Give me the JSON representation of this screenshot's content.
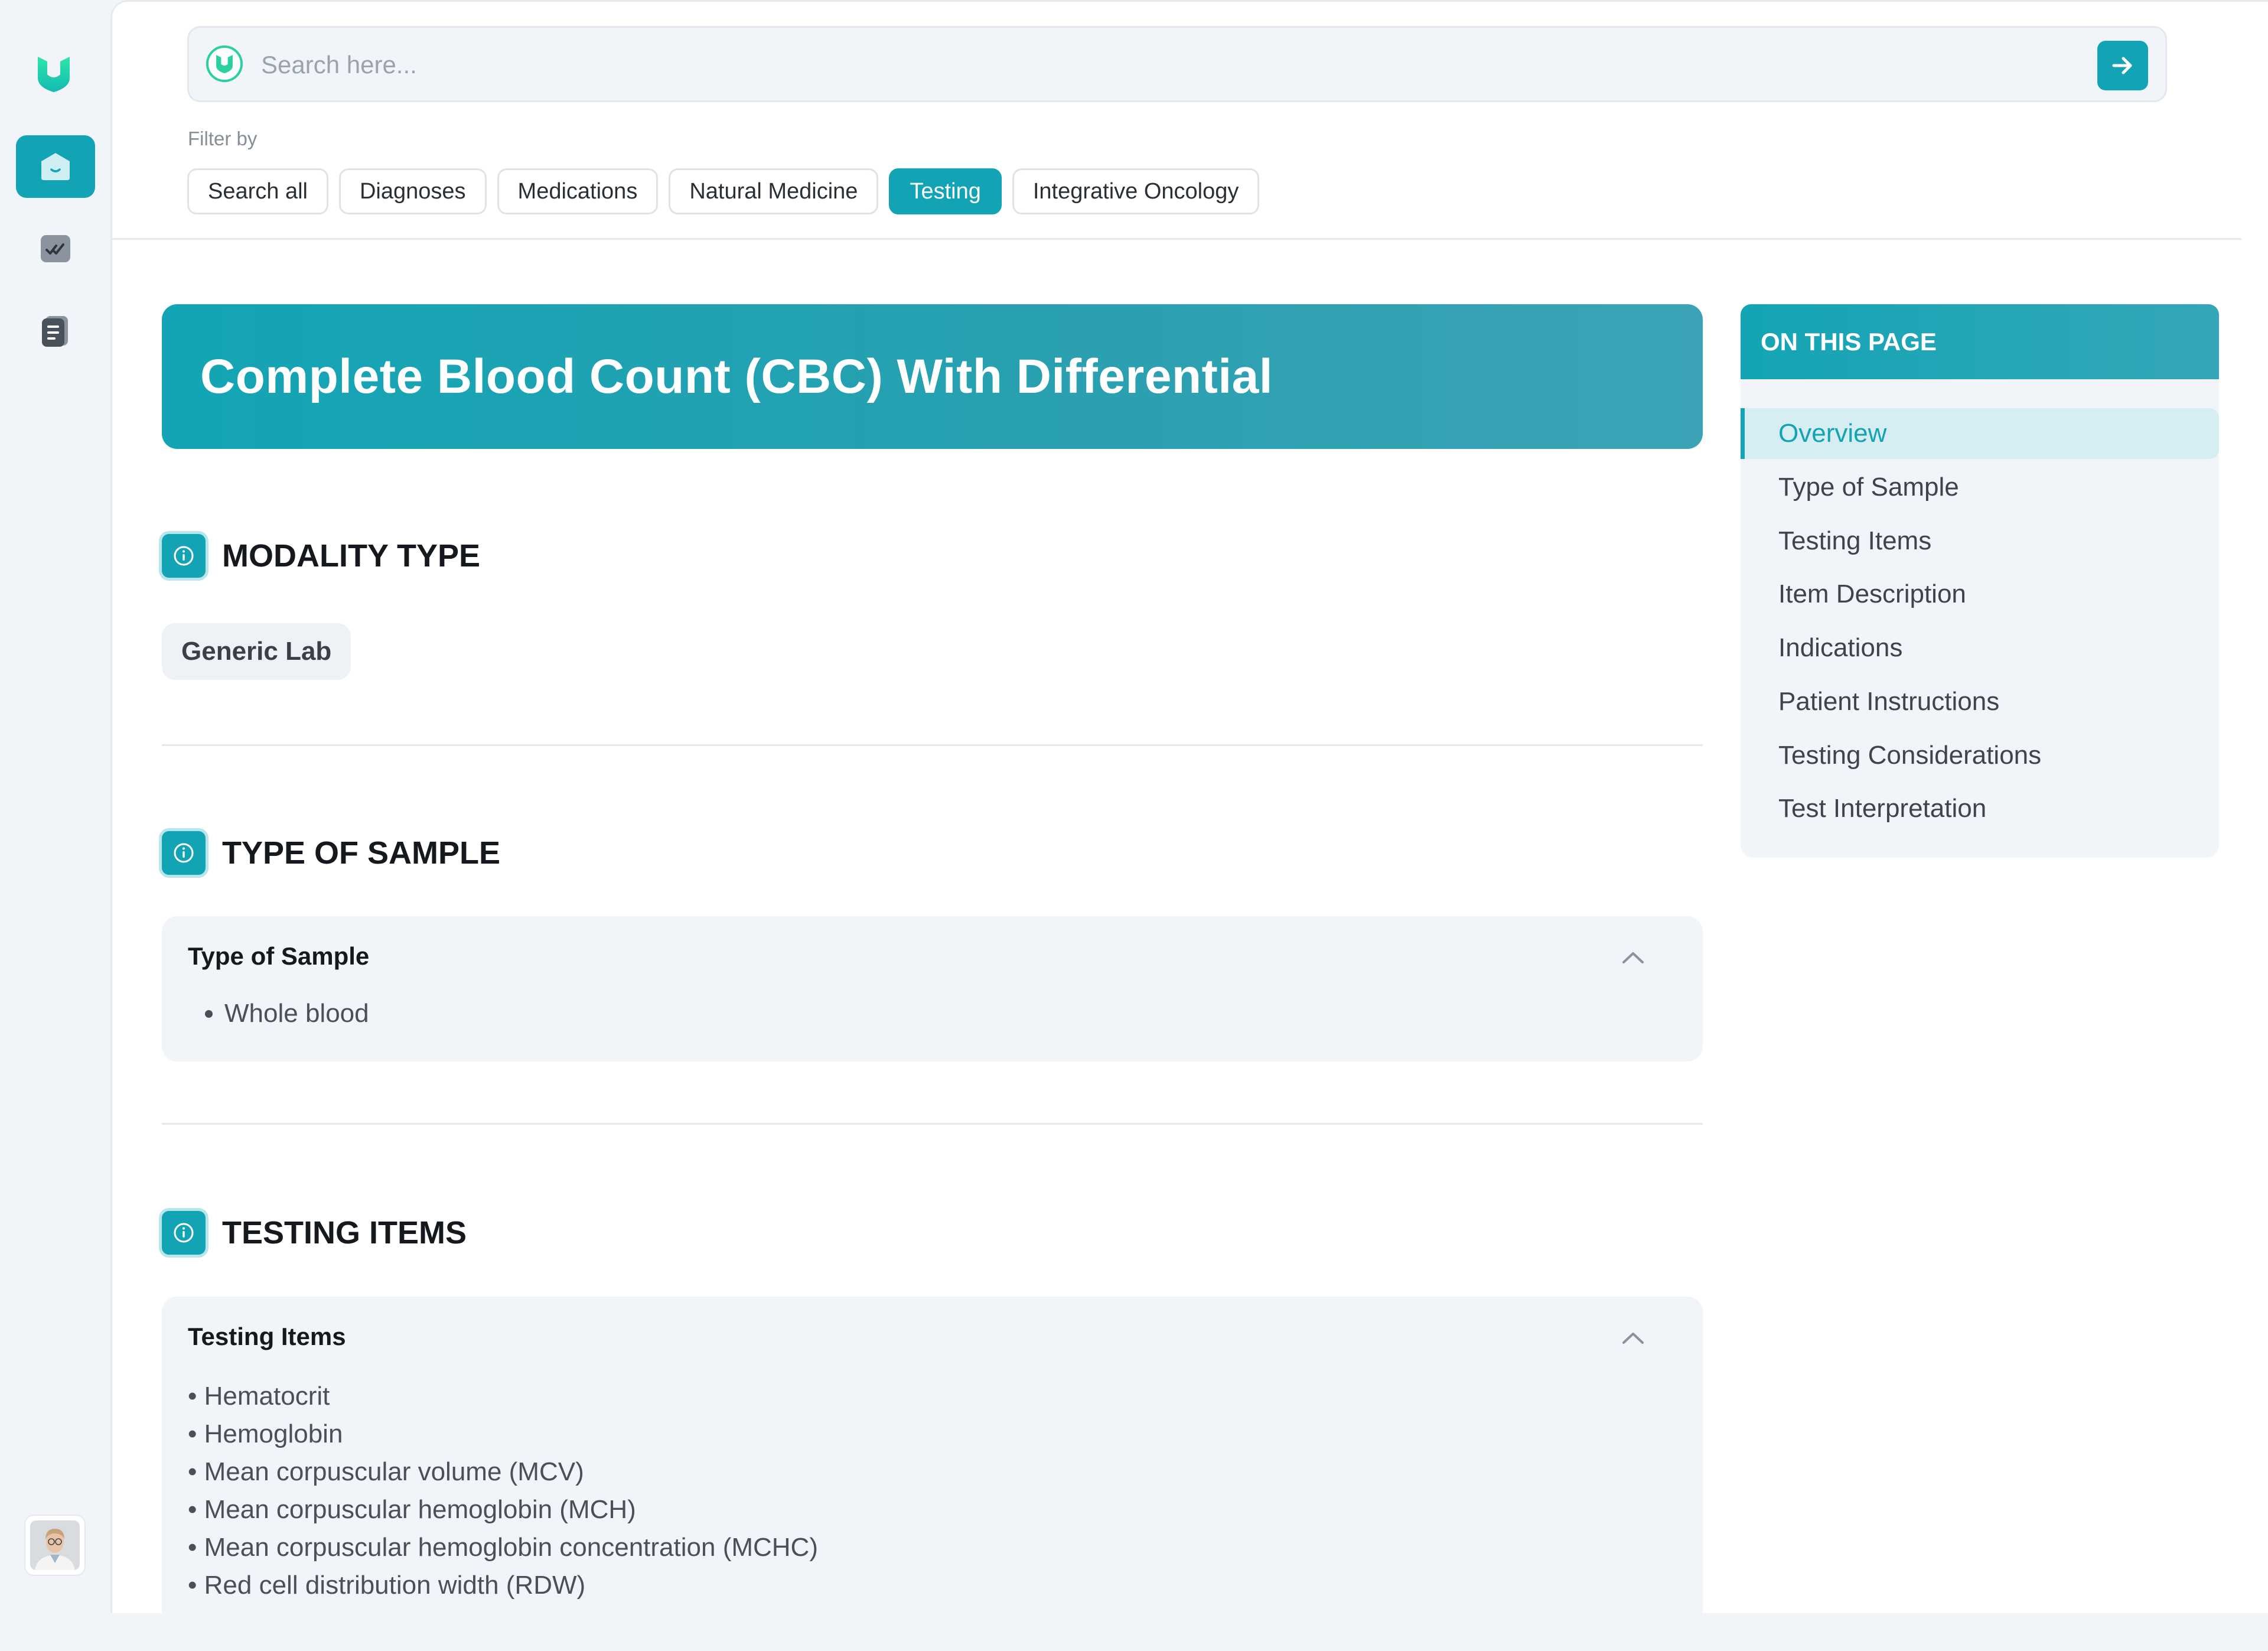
{
  "search": {
    "placeholder": "Search here..."
  },
  "filters": {
    "label": "Filter by",
    "chips": [
      {
        "label": "Search all",
        "active": false
      },
      {
        "label": "Diagnoses",
        "active": false
      },
      {
        "label": "Medications",
        "active": false
      },
      {
        "label": "Natural Medicine",
        "active": false
      },
      {
        "label": "Testing",
        "active": true
      },
      {
        "label": "Integrative Oncology",
        "active": false
      }
    ]
  },
  "page": {
    "title": "Complete Blood Count (CBC) With Differential"
  },
  "sections": {
    "modality": {
      "heading": "MODALITY TYPE",
      "value": "Generic Lab"
    },
    "sample": {
      "heading": "TYPE OF SAMPLE",
      "panel_title": "Type of Sample",
      "items": [
        "Whole blood"
      ]
    },
    "testing": {
      "heading": "TESTING ITEMS",
      "panel_title": "Testing Items",
      "items": [
        "• Hematocrit",
        "• Hemoglobin",
        "• Mean corpuscular volume (MCV)",
        "• Mean corpuscular hemoglobin (MCH)",
        "• Mean corpuscular hemoglobin concentration (MCHC)",
        "• Red cell distribution width (RDW)"
      ]
    }
  },
  "toc": {
    "title": "ON THIS PAGE",
    "items": [
      "Overview",
      "Type of Sample",
      "Testing Items",
      "Item Description",
      "Indications",
      "Patient Instructions",
      "Testing Considerations",
      "Test Interpretation"
    ],
    "active_index": 0
  },
  "colors": {
    "accent": "#12a3b4",
    "brand_green": "#2bd0a0"
  },
  "icons": {
    "logo": "shield-logo-icon",
    "nav": [
      "home-icon",
      "check-list-icon",
      "document-icon"
    ],
    "search_go": "arrow-right-icon",
    "section": "info-icon",
    "panel_toggle": "chevron-up-icon"
  }
}
